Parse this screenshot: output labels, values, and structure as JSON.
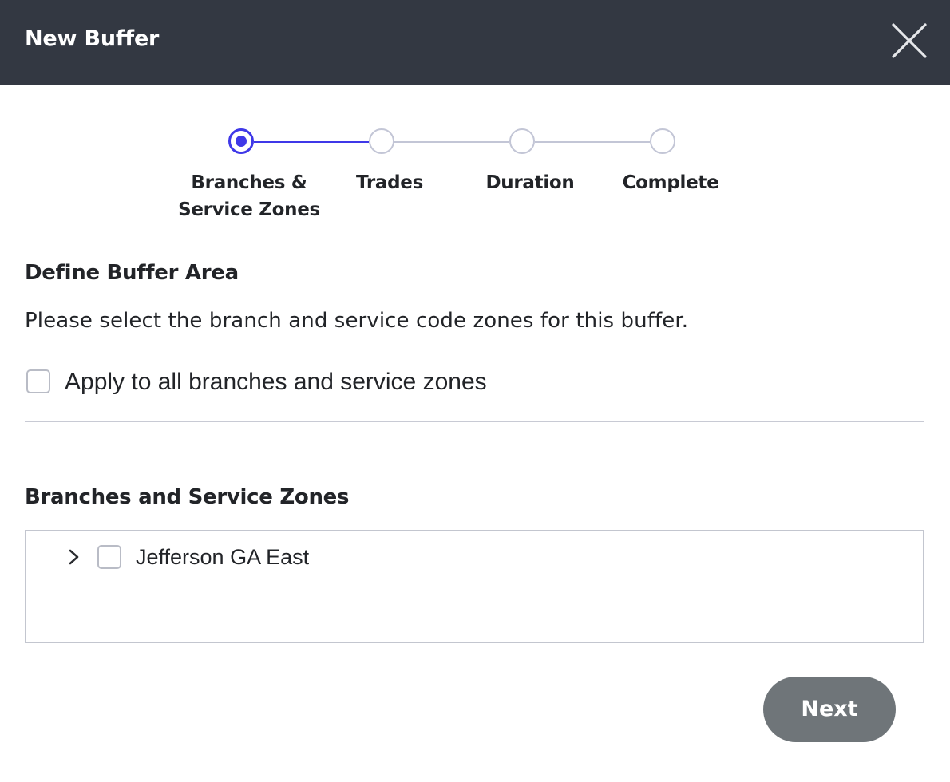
{
  "dialog": {
    "title": "New Buffer",
    "close_icon": "close-icon"
  },
  "stepper": {
    "accent_color": "#3f38e8",
    "inactive_color": "#c3c6d6",
    "steps": [
      {
        "label": "Branches & Service Zones",
        "state": "active"
      },
      {
        "label": "Trades",
        "state": "pending"
      },
      {
        "label": "Duration",
        "state": "pending"
      },
      {
        "label": "Complete",
        "state": "pending"
      }
    ]
  },
  "define_section": {
    "title": "Define Buffer Area",
    "description": "Please select the branch and service code zones for this buffer.",
    "apply_all_label": "Apply to all branches and service zones",
    "apply_all_checked": false
  },
  "branches_section": {
    "title": "Branches and Service Zones",
    "items": [
      {
        "label": "Jefferson GA East",
        "checked": false,
        "expanded": false,
        "expand_icon": "chevron-right-icon"
      }
    ]
  },
  "footer": {
    "next_label": "Next",
    "next_color": "#6f7579"
  }
}
